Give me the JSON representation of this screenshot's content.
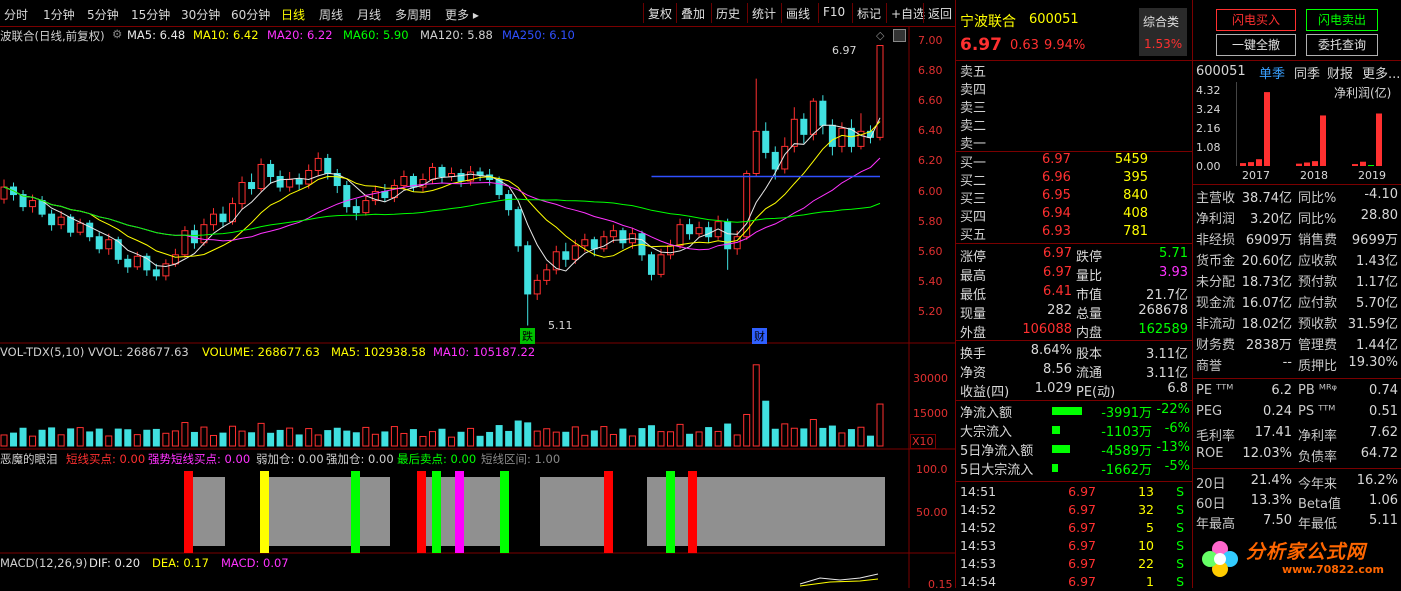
{
  "toolbar": {
    "periods": [
      "分时",
      "1分钟",
      "5分钟",
      "15分钟",
      "30分钟",
      "60分钟",
      "日线",
      "周线",
      "月线",
      "多周期",
      "更多"
    ],
    "active_period": "日线",
    "right": [
      "复权",
      "叠加",
      "历史",
      "统计",
      "画线",
      "F10",
      "标记",
      "+自选",
      "返回"
    ]
  },
  "main_chart": {
    "indicator_line": {
      "name": "波联合(日线,前复权)",
      "ma5": "MA5: 6.48",
      "ma10": "MA10: 6.42",
      "ma20": "MA20: 6.22",
      "ma60": "MA60: 5.90",
      "ma120": "MA120: 5.88",
      "ma250": "MA250: 6.10"
    },
    "y_ticks": [
      "7.00",
      "6.80",
      "6.60",
      "6.40",
      "6.20",
      "6.00",
      "5.80",
      "5.60",
      "5.40",
      "5.20"
    ],
    "high_label": "6.97",
    "low_label": "5.11",
    "marker_die": "跌",
    "marker_cai": "财",
    "candles": [
      [
        5.95,
        6.03,
        6.08,
        5.92
      ],
      [
        6.03,
        5.98,
        6.06,
        5.94
      ],
      [
        5.98,
        5.9,
        6.01,
        5.87
      ],
      [
        5.9,
        5.94,
        5.98,
        5.86
      ],
      [
        5.94,
        5.85,
        5.97,
        5.83
      ],
      [
        5.85,
        5.78,
        5.88,
        5.74
      ],
      [
        5.78,
        5.83,
        5.87,
        5.75
      ],
      [
        5.83,
        5.73,
        5.85,
        5.7
      ],
      [
        5.73,
        5.79,
        5.82,
        5.71
      ],
      [
        5.79,
        5.7,
        5.81,
        5.67
      ],
      [
        5.7,
        5.62,
        5.73,
        5.59
      ],
      [
        5.62,
        5.68,
        5.72,
        5.58
      ],
      [
        5.68,
        5.55,
        5.7,
        5.52
      ],
      [
        5.55,
        5.5,
        5.58,
        5.46
      ],
      [
        5.5,
        5.57,
        5.6,
        5.48
      ],
      [
        5.57,
        5.48,
        5.59,
        5.44
      ],
      [
        5.48,
        5.44,
        5.52,
        5.41
      ],
      [
        5.44,
        5.52,
        5.55,
        5.41
      ],
      [
        5.52,
        5.58,
        5.62,
        5.5
      ],
      [
        5.58,
        5.74,
        5.77,
        5.56
      ],
      [
        5.74,
        5.66,
        5.78,
        5.62
      ],
      [
        5.66,
        5.78,
        5.82,
        5.64
      ],
      [
        5.78,
        5.85,
        5.89,
        5.74
      ],
      [
        5.85,
        5.8,
        5.9,
        5.76
      ],
      [
        5.8,
        5.92,
        5.96,
        5.78
      ],
      [
        5.92,
        6.06,
        6.1,
        5.88
      ],
      [
        6.06,
        6.02,
        6.12,
        5.98
      ],
      [
        6.02,
        6.18,
        6.22,
        6.0
      ],
      [
        6.18,
        6.1,
        6.21,
        6.05
      ],
      [
        6.1,
        6.03,
        6.14,
        6.0
      ],
      [
        6.03,
        6.08,
        6.13,
        6.0
      ],
      [
        6.08,
        6.05,
        6.12,
        6.01
      ],
      [
        6.05,
        6.14,
        6.18,
        6.02
      ],
      [
        6.14,
        6.22,
        6.26,
        6.1
      ],
      [
        6.22,
        6.12,
        6.25,
        6.08
      ],
      [
        6.12,
        6.04,
        6.15,
        5.99
      ],
      [
        6.04,
        5.9,
        6.07,
        5.86
      ],
      [
        5.9,
        5.86,
        5.95,
        5.81
      ],
      [
        5.86,
        5.94,
        5.98,
        5.84
      ],
      [
        5.94,
        6.0,
        6.04,
        5.91
      ],
      [
        6.0,
        5.96,
        6.05,
        5.93
      ],
      [
        5.96,
        6.04,
        6.08,
        5.93
      ],
      [
        6.04,
        6.1,
        6.14,
        6.01
      ],
      [
        6.1,
        6.03,
        6.12,
        6.0
      ],
      [
        6.03,
        6.08,
        6.12,
        6.0
      ],
      [
        6.08,
        6.16,
        6.19,
        6.05
      ],
      [
        6.16,
        6.1,
        6.18,
        6.06
      ],
      [
        6.1,
        6.12,
        6.16,
        6.07
      ],
      [
        6.12,
        6.07,
        6.15,
        6.03
      ],
      [
        6.07,
        6.13,
        6.17,
        6.04
      ],
      [
        6.13,
        6.11,
        6.16,
        6.07
      ],
      [
        6.11,
        6.08,
        6.15,
        6.04
      ],
      [
        6.08,
        5.98,
        6.1,
        5.95
      ],
      [
        5.98,
        5.88,
        6.01,
        5.84
      ],
      [
        5.88,
        5.64,
        5.9,
        5.6
      ],
      [
        5.64,
        5.32,
        5.67,
        5.11
      ],
      [
        5.32,
        5.41,
        5.45,
        5.28
      ],
      [
        5.41,
        5.48,
        5.52,
        5.38
      ],
      [
        5.48,
        5.6,
        5.64,
        5.45
      ],
      [
        5.6,
        5.55,
        5.66,
        5.5
      ],
      [
        5.55,
        5.64,
        5.68,
        5.52
      ],
      [
        5.64,
        5.68,
        5.72,
        5.6
      ],
      [
        5.68,
        5.62,
        5.7,
        5.57
      ],
      [
        5.62,
        5.7,
        5.74,
        5.6
      ],
      [
        5.7,
        5.74,
        5.78,
        5.66
      ],
      [
        5.74,
        5.66,
        5.76,
        5.62
      ],
      [
        5.66,
        5.72,
        5.76,
        5.62
      ],
      [
        5.72,
        5.58,
        5.74,
        5.54
      ],
      [
        5.58,
        5.45,
        5.6,
        5.41
      ],
      [
        5.45,
        5.58,
        5.62,
        5.43
      ],
      [
        5.58,
        5.64,
        5.68,
        5.55
      ],
      [
        5.64,
        5.78,
        5.82,
        5.62
      ],
      [
        5.78,
        5.72,
        5.82,
        5.68
      ],
      [
        5.72,
        5.76,
        5.8,
        5.7
      ],
      [
        5.76,
        5.7,
        5.8,
        5.66
      ],
      [
        5.7,
        5.8,
        5.84,
        5.68
      ],
      [
        5.8,
        5.62,
        5.82,
        5.48
      ],
      [
        5.62,
        5.7,
        5.74,
        5.58
      ],
      [
        5.7,
        6.12,
        6.14,
        5.68
      ],
      [
        6.12,
        6.4,
        6.75,
        6.1
      ],
      [
        6.4,
        6.26,
        6.46,
        6.22
      ],
      [
        6.26,
        6.15,
        6.3,
        6.08
      ],
      [
        6.15,
        6.3,
        6.36,
        6.12
      ],
      [
        6.3,
        6.48,
        6.56,
        6.26
      ],
      [
        6.48,
        6.38,
        6.52,
        6.32
      ],
      [
        6.38,
        6.6,
        6.62,
        6.34
      ],
      [
        6.6,
        6.44,
        6.64,
        6.38
      ],
      [
        6.44,
        6.3,
        6.48,
        6.24
      ],
      [
        6.3,
        6.42,
        6.46,
        6.26
      ],
      [
        6.42,
        6.3,
        6.48,
        6.26
      ],
      [
        6.3,
        6.4,
        6.52,
        6.28
      ],
      [
        6.4,
        6.36,
        6.44,
        6.32
      ],
      [
        6.36,
        6.97,
        6.97,
        6.34
      ]
    ],
    "blue_line": {
      "from_index": 68,
      "value": 6.1
    },
    "ma_colors": {
      "ma5": "#e8e8e8",
      "ma10": "#ffff00",
      "ma20": "#ff33ff",
      "ma60": "#00ff00",
      "ma120": "#40e0e0",
      "ma250": "#3050ff"
    }
  },
  "volume_chart": {
    "label": "VOL-TDX(5,10)",
    "vvol": "VVOL: 268677.63",
    "volume": "VOLUME: 268677.63",
    "ma5": "MA5: 102938.58",
    "ma10": "MA10: 105187.22",
    "y_ticks": [
      "30000",
      "15000"
    ],
    "x10": "X10"
  },
  "devil_chart": {
    "name": "恶魔的眼泪",
    "s1": "短线买点: 0.00",
    "s2": "强势短线买点: 0.00",
    "s3": "弱加仓: 0.00",
    "s4": "强加仓: 0.00",
    "s5": "最后卖点: 0.00",
    "s6": "短线区间: 1.00",
    "y_ticks": [
      "100.0",
      "50.00"
    ]
  },
  "macd_chart": {
    "name": "MACD(12,26,9)",
    "dif": "DIF: 0.20",
    "dea": "DEA: 0.17",
    "macd": "MACD: 0.07",
    "y_tick": "0.15"
  },
  "quote": {
    "name": "宁波联合",
    "code": "600051",
    "tag": "综合类",
    "tag_pct": "1.53%",
    "price": "6.97",
    "change": "0.63",
    "change_pct": "9.94%",
    "sells": [
      {
        "l": "卖五",
        "p": "",
        "v": ""
      },
      {
        "l": "卖四",
        "p": "",
        "v": ""
      },
      {
        "l": "卖三",
        "p": "",
        "v": ""
      },
      {
        "l": "卖二",
        "p": "",
        "v": ""
      },
      {
        "l": "卖一",
        "p": "",
        "v": ""
      }
    ],
    "buys": [
      {
        "l": "买一",
        "p": "6.97",
        "v": "5459"
      },
      {
        "l": "买二",
        "p": "6.96",
        "v": "395"
      },
      {
        "l": "买三",
        "p": "6.95",
        "v": "840"
      },
      {
        "l": "买四",
        "p": "6.94",
        "v": "408"
      },
      {
        "l": "买五",
        "p": "6.93",
        "v": "781"
      }
    ],
    "stats1": [
      {
        "a": "涨停",
        "av": "6.97",
        "b": "跌停",
        "bv": "5.71"
      },
      {
        "a": "最高",
        "av": "6.97",
        "b": "量比",
        "bv": "3.93"
      },
      {
        "a": "最低",
        "av": "6.41",
        "b": "市值",
        "bv": "21.7亿"
      },
      {
        "a": "现量",
        "av": "282",
        "b": "总量",
        "bv": "268678"
      },
      {
        "a": "外盘",
        "av": "106088",
        "b": "内盘",
        "bv": "162589"
      }
    ],
    "stats2": [
      {
        "a": "换手",
        "av": "8.64%",
        "b": "股本",
        "bv": "3.11亿"
      },
      {
        "a": "净资",
        "av": "8.56",
        "b": "流通",
        "bv": "3.11亿"
      },
      {
        "a": "收益(四)",
        "av": "1.029",
        "b": "PE(动)",
        "bv": "6.8"
      }
    ],
    "flows": [
      {
        "l": "净流入额",
        "v": "-3991万",
        "p": "-22%",
        "w": 30
      },
      {
        "l": "大宗流入",
        "v": "-1103万",
        "p": "-6%",
        "w": 8
      },
      {
        "l": "5日净流入额",
        "v": "-4589万",
        "p": "-13%",
        "w": 18
      },
      {
        "l": "5日大宗流入",
        "v": "-1662万",
        "p": "-5%",
        "w": 6
      }
    ],
    "ticks": [
      {
        "t": "14:51",
        "p": "6.97",
        "v": "13",
        "s": "S"
      },
      {
        "t": "14:52",
        "p": "6.97",
        "v": "32",
        "s": "S"
      },
      {
        "t": "14:52",
        "p": "6.97",
        "v": "5",
        "s": "S"
      },
      {
        "t": "14:53",
        "p": "6.97",
        "v": "10",
        "s": "S"
      },
      {
        "t": "14:53",
        "p": "6.97",
        "v": "22",
        "s": "S"
      },
      {
        "t": "14:54",
        "p": "6.97",
        "v": "1",
        "s": "S"
      }
    ]
  },
  "right_panel": {
    "btn_buy": "闪电买入",
    "btn_sell": "闪电卖出",
    "btn_cancel": "一键全撤",
    "btn_entrust": "委托查询",
    "code": "600051",
    "tabs": [
      "单季",
      "同季",
      "财报",
      "更多"
    ],
    "net_profit": "净利润(亿)",
    "profit_y": [
      "4.32",
      "3.24",
      "2.16",
      "1.08",
      "0.00"
    ],
    "years": [
      "2017",
      "2018",
      "2019"
    ],
    "bars": [
      0.15,
      0.2,
      0.35,
      3.8,
      0.12,
      0.18,
      0.25,
      2.6,
      0.1,
      0.22,
      0.05,
      2.7
    ],
    "fin": [
      {
        "a": "主营收",
        "av": "38.74亿",
        "b": "同比%",
        "bv": "-4.10"
      },
      {
        "a": "净利润",
        "av": "3.20亿",
        "b": "同比%",
        "bv": "28.80"
      },
      {
        "a": "非经损",
        "av": "6909万",
        "b": "销售费",
        "bv": "9699万"
      },
      {
        "a": "货币金",
        "av": "20.60亿",
        "b": "应收款",
        "bv": "1.43亿"
      },
      {
        "a": "未分配",
        "av": "18.73亿",
        "b": "预付款",
        "bv": "1.17亿"
      },
      {
        "a": "现金流",
        "av": "16.07亿",
        "b": "应付款",
        "bv": "5.70亿"
      },
      {
        "a": "非流动",
        "av": "18.02亿",
        "b": "预收款",
        "bv": "31.59亿"
      },
      {
        "a": "财务费",
        "av": "2838万",
        "b": "管理费",
        "bv": "1.44亿"
      },
      {
        "a": "商誉",
        "av": "--",
        "b": "质押比",
        "bv": "19.30%"
      }
    ],
    "fin2": [
      {
        "a": "PE ᵀᵀᴹ",
        "av": "6.2",
        "b": "PB ᴹᴿᵠ",
        "bv": "0.74"
      },
      {
        "a": "PEG",
        "av": "0.24",
        "b": "PS ᵀᵀᴹ",
        "bv": "0.51"
      },
      {
        "a": "毛利率",
        "av": "17.41",
        "b": "净利率",
        "bv": "7.62"
      },
      {
        "a": "ROE",
        "av": "12.03%",
        "b": "负债率",
        "bv": "64.72"
      }
    ],
    "fin3": [
      {
        "a": "20日",
        "av": "21.4%",
        "b": "今年来",
        "bv": "16.2%"
      },
      {
        "a": "60日",
        "av": "13.3%",
        "b": "Beta值",
        "bv": "1.06"
      },
      {
        "a": "年最高",
        "av": "7.50",
        "b": "年最低",
        "bv": "5.11"
      }
    ],
    "watermark": "分析家公式网",
    "watermark_url": "www.70822.com"
  }
}
